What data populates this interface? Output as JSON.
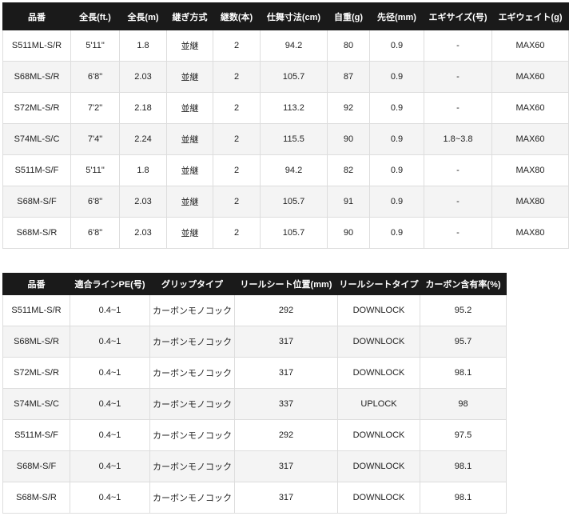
{
  "table1": {
    "headers": [
      "品番",
      "全長(ft.)",
      "全長(m)",
      "継ぎ方式",
      "継数(本)",
      "仕舞寸法(cm)",
      "自重(g)",
      "先径(mm)",
      "エギサイズ(号)",
      "エギウェイト(g)"
    ],
    "rows": [
      [
        "S511ML-S/R",
        "5'11\"",
        "1.8",
        "並継",
        "2",
        "94.2",
        "80",
        "0.9",
        "-",
        "MAX60"
      ],
      [
        "S68ML-S/R",
        "6'8\"",
        "2.03",
        "並継",
        "2",
        "105.7",
        "87",
        "0.9",
        "-",
        "MAX60"
      ],
      [
        "S72ML-S/R",
        "7'2\"",
        "2.18",
        "並継",
        "2",
        "113.2",
        "92",
        "0.9",
        "-",
        "MAX60"
      ],
      [
        "S74ML-S/C",
        "7'4\"",
        "2.24",
        "並継",
        "2",
        "115.5",
        "90",
        "0.9",
        "1.8~3.8",
        "MAX60"
      ],
      [
        "S511M-S/F",
        "5'11\"",
        "1.8",
        "並継",
        "2",
        "94.2",
        "82",
        "0.9",
        "-",
        "MAX80"
      ],
      [
        "S68M-S/F",
        "6'8\"",
        "2.03",
        "並継",
        "2",
        "105.7",
        "91",
        "0.9",
        "-",
        "MAX80"
      ],
      [
        "S68M-S/R",
        "6'8\"",
        "2.03",
        "並継",
        "2",
        "105.7",
        "90",
        "0.9",
        "-",
        "MAX80"
      ]
    ]
  },
  "table2": {
    "headers": [
      "品番",
      "適合ラインPE(号)",
      "グリップタイプ",
      "リールシート位置(mm)",
      "リールシートタイプ",
      "カーボン含有率(%)"
    ],
    "rows": [
      [
        "S511ML-S/R",
        "0.4~1",
        "カーボンモノコック",
        "292",
        "DOWNLOCK",
        "95.2"
      ],
      [
        "S68ML-S/R",
        "0.4~1",
        "カーボンモノコック",
        "317",
        "DOWNLOCK",
        "95.7"
      ],
      [
        "S72ML-S/R",
        "0.4~1",
        "カーボンモノコック",
        "317",
        "DOWNLOCK",
        "98.1"
      ],
      [
        "S74ML-S/C",
        "0.4~1",
        "カーボンモノコック",
        "337",
        "UPLOCK",
        "98"
      ],
      [
        "S511M-S/F",
        "0.4~1",
        "カーボンモノコック",
        "292",
        "DOWNLOCK",
        "97.5"
      ],
      [
        "S68M-S/F",
        "0.4~1",
        "カーボンモノコック",
        "317",
        "DOWNLOCK",
        "98.1"
      ],
      [
        "S68M-S/R",
        "0.4~1",
        "カーボンモノコック",
        "317",
        "DOWNLOCK",
        "98.1"
      ]
    ]
  }
}
